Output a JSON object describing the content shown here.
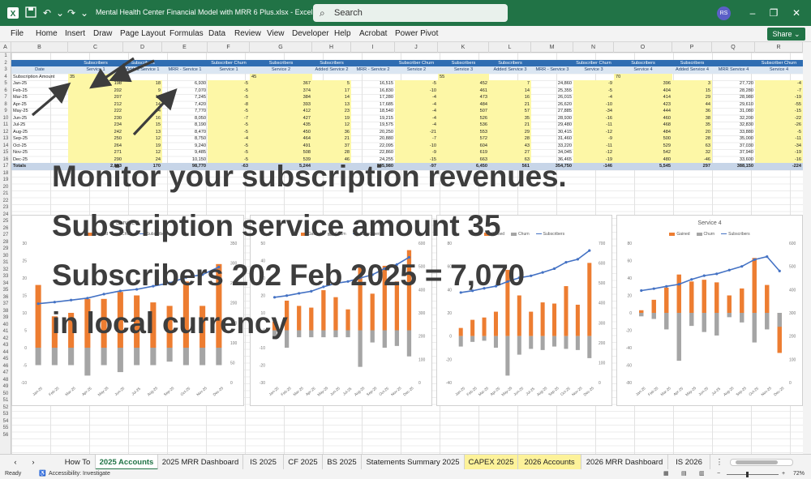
{
  "window": {
    "title": "Mental Health Center Financial Model with MRR 6 Plus.xlsx  -  Excel",
    "search_placeholder": "Search",
    "user_initials": "RS"
  },
  "ribbon": {
    "tabs": [
      "File",
      "Home",
      "Insert",
      "Draw",
      "Page Layout",
      "Formulas",
      "Data",
      "Review",
      "View",
      "Developer",
      "Help",
      "Acrobat",
      "Power Pivot"
    ],
    "share_label": "Share"
  },
  "columns": [
    "A",
    "B",
    "C",
    "D",
    "E",
    "F",
    "G",
    "H",
    "I",
    "J",
    "K",
    "L",
    "M",
    "N",
    "O",
    "P",
    "Q",
    "R"
  ],
  "rows": [
    "1",
    "2",
    "3",
    "4",
    "5",
    "6",
    "7",
    "8",
    "9",
    "10",
    "11",
    "12",
    "13",
    "14",
    "15",
    "16",
    "17",
    "18",
    "19",
    "20",
    "21",
    "22",
    "23",
    "24",
    "25",
    "26",
    "27",
    "28",
    "29",
    "30",
    "31",
    "32",
    "33",
    "34",
    "35",
    "36",
    "37",
    "38",
    "39",
    "40",
    "41",
    "42",
    "43",
    "44",
    "45",
    "46",
    "47",
    "48",
    "49",
    "50",
    "51",
    "52",
    "53",
    "54",
    "55",
    "56"
  ],
  "table": {
    "group_headers": [
      "Subscribers",
      "Subscribers",
      "",
      "Subscriber Churn",
      "Subscribers",
      "Subscribers",
      "",
      "Subscriber Churn",
      "Subscribers",
      "Subscribers",
      "",
      "Subscriber Churn",
      "Subscribers",
      "Subscribers",
      "",
      "Subscriber Churn"
    ],
    "col_headers": [
      "Date",
      "Service 1",
      "Added Service 1",
      "MRR - Service 1",
      "Service 1",
      "Service 2",
      "Added Service 2",
      "MRR - Service 2",
      "Service 2",
      "Service 3",
      "Added Service 3",
      "MRR - Service 3",
      "Service 3",
      "Service 4",
      "Added Service 4",
      "MRR Service 4",
      "Service 4"
    ],
    "amount_label": "Subscription Amount",
    "amounts": [
      "35",
      "45",
      "55",
      "70"
    ],
    "months": [
      "Jan-25",
      "Feb-25",
      "Mar-25",
      "Apr-25",
      "May-25",
      "Jun-25",
      "Jul-25",
      "Aug-25",
      "Sep-25",
      "Oct-25",
      "Nov-25",
      "Dec-25"
    ],
    "svc1": {
      "subs": [
        "198",
        "202",
        "207",
        "212",
        "222",
        "230",
        "234",
        "242",
        "250",
        "264",
        "271",
        "290"
      ],
      "added": [
        "18",
        "9",
        "10",
        "14",
        "14",
        "16",
        "15",
        "13",
        "12",
        "19",
        "12",
        "24"
      ],
      "mrr": [
        "6,930",
        "7,070",
        "7,245",
        "7,420",
        "7,770",
        "8,050",
        "8,190",
        "8,470",
        "8,750",
        "9,240",
        "9,485",
        "10,150"
      ],
      "churn": [
        "-5",
        "-5",
        "-5",
        "-8",
        "-5",
        "-7",
        "-5",
        "-5",
        "-4",
        "-5",
        "-5",
        "-5"
      ]
    },
    "svc2": {
      "subs": [
        "367",
        "374",
        "384",
        "393",
        "412",
        "427",
        "435",
        "450",
        "464",
        "491",
        "508",
        "539"
      ],
      "added": [
        "5",
        "17",
        "14",
        "13",
        "23",
        "19",
        "12",
        "36",
        "21",
        "37",
        "28",
        "46"
      ],
      "mrr": [
        "16,515",
        "16,830",
        "17,280",
        "17,685",
        "18,540",
        "19,215",
        "19,575",
        "20,250",
        "20,880",
        "22,095",
        "22,860",
        "24,255"
      ],
      "churn": [
        "-5",
        "-10",
        "-4",
        "-4",
        "-4",
        "-4",
        "-4",
        "-21",
        "-7",
        "-10",
        "-9",
        "-15"
      ]
    },
    "svc3": {
      "subs": [
        "452",
        "461",
        "473",
        "484",
        "507",
        "526",
        "536",
        "553",
        "572",
        "604",
        "619",
        "663"
      ],
      "added": [
        "7",
        "14",
        "16",
        "21",
        "57",
        "35",
        "21",
        "29",
        "28",
        "43",
        "27",
        "63"
      ],
      "mrr": [
        "24,860",
        "25,355",
        "26,015",
        "26,620",
        "27,885",
        "28,930",
        "29,480",
        "30,415",
        "31,460",
        "33,220",
        "34,045",
        "36,465"
      ],
      "churn": [
        "-9",
        "-5",
        "-4",
        "-10",
        "-34",
        "-16",
        "-11",
        "-12",
        "-9",
        "-11",
        "-12",
        "-19"
      ]
    },
    "svc4": {
      "subs": [
        "396",
        "404",
        "414",
        "423",
        "444",
        "460",
        "468",
        "484",
        "500",
        "529",
        "542",
        "480"
      ],
      "added": [
        "3",
        "15",
        "29",
        "44",
        "36",
        "38",
        "35",
        "20",
        "28",
        "63",
        "32",
        "-46"
      ],
      "mrr": [
        "27,720",
        "28,280",
        "28,980",
        "29,610",
        "31,080",
        "32,200",
        "32,830",
        "33,880",
        "35,000",
        "37,030",
        "37,940",
        "33,600"
      ],
      "churn": [
        "-4",
        "-7",
        "-19",
        "-55",
        "-15",
        "-22",
        "-26",
        "-5",
        "-11",
        "-34",
        "-19",
        "-16"
      ]
    },
    "totals_label": "Totals",
    "totals": [
      "2,823",
      "170",
      "98,770",
      "-63",
      "5,244",
      "",
      "235,980",
      "-97",
      "6,450",
      "561",
      "354,750",
      "-146",
      "5,545",
      "297",
      "388,150",
      "-224"
    ]
  },
  "chart_data": [
    {
      "type": "bar",
      "title": "Service 1",
      "legend": [
        "Gained",
        "Churn",
        "Subscribers"
      ],
      "categories": [
        "Jan-25",
        "Feb-25",
        "Mar-25",
        "Apr-25",
        "May-25",
        "Jun-25",
        "Jul-25",
        "Aug-25",
        "Sep-25",
        "Oct-25",
        "Nov-25",
        "Dec-25"
      ],
      "series": [
        {
          "name": "Gained",
          "values": [
            18,
            9,
            10,
            14,
            14,
            16,
            15,
            13,
            12,
            19,
            12,
            24
          ]
        },
        {
          "name": "Churn",
          "values": [
            -5,
            -5,
            -5,
            -8,
            -5,
            -7,
            -5,
            -5,
            -4,
            -5,
            -5,
            -5
          ]
        },
        {
          "name": "Subscribers",
          "values": [
            198,
            202,
            207,
            212,
            222,
            230,
            234,
            242,
            250,
            264,
            271,
            290
          ]
        }
      ],
      "ylim": [
        -10,
        30
      ],
      "y2lim": [
        0,
        350
      ],
      "yticks": [
        30,
        25,
        20,
        15,
        10,
        5,
        0,
        -5,
        -10
      ],
      "y2ticks": [
        350,
        300,
        250,
        200,
        150,
        100,
        50,
        0
      ]
    },
    {
      "type": "bar",
      "title": "",
      "legend": [
        "Gained",
        "Churn",
        "Subscribers"
      ],
      "categories": [
        "Jan-25",
        "Feb-25",
        "Mar-25",
        "Apr-25",
        "May-25",
        "Jun-25",
        "Jul-25",
        "Aug-25",
        "Sep-25",
        "Oct-25",
        "Nov-25",
        "Dec-25"
      ],
      "series": [
        {
          "name": "Gained",
          "values": [
            5,
            17,
            14,
            13,
            23,
            19,
            12,
            36,
            21,
            37,
            28,
            46
          ]
        },
        {
          "name": "Churn",
          "values": [
            -5,
            -10,
            -4,
            -4,
            -4,
            -4,
            -4,
            -21,
            -7,
            -10,
            -9,
            -15
          ]
        },
        {
          "name": "Subscribers",
          "values": [
            367,
            374,
            384,
            393,
            412,
            427,
            435,
            450,
            464,
            491,
            508,
            539
          ]
        }
      ],
      "ylim": [
        -30,
        50
      ],
      "y2lim": [
        0,
        600
      ],
      "yticks": [
        50,
        40,
        30,
        20,
        10,
        0,
        -10,
        -20,
        -30
      ],
      "y2ticks": [
        600,
        500,
        400,
        300,
        200,
        100,
        0
      ]
    },
    {
      "type": "bar",
      "title": "",
      "legend": [
        "Gained",
        "Churn",
        "Subscribers"
      ],
      "categories": [
        "Jan-25",
        "Feb-25",
        "Mar-25",
        "Apr-25",
        "May-25",
        "Jun-25",
        "Jul-25",
        "Aug-25",
        "Sep-25",
        "Oct-25",
        "Nov-25",
        "Dec-25"
      ],
      "series": [
        {
          "name": "Gained",
          "values": [
            7,
            14,
            16,
            21,
            57,
            35,
            21,
            29,
            28,
            43,
            27,
            63
          ]
        },
        {
          "name": "Churn",
          "values": [
            -9,
            -5,
            -4,
            -10,
            -34,
            -16,
            -11,
            -12,
            -9,
            -11,
            -12,
            -19
          ]
        },
        {
          "name": "Subscribers",
          "values": [
            452,
            461,
            473,
            484,
            507,
            526,
            536,
            553,
            572,
            604,
            619,
            663
          ]
        }
      ],
      "ylim": [
        -40,
        80
      ],
      "y2lim": [
        0,
        700
      ],
      "yticks": [
        80,
        60,
        40,
        20,
        0,
        -20,
        -40
      ],
      "y2ticks": [
        700,
        600,
        500,
        400,
        300,
        200,
        100,
        0
      ]
    },
    {
      "type": "bar",
      "title": "Service 4",
      "legend": [
        "Gained",
        "Churn",
        "Subscribers"
      ],
      "categories": [
        "Jan-25",
        "Feb-25",
        "Mar-25",
        "Apr-25",
        "May-25",
        "Jun-25",
        "Jul-25",
        "Aug-25",
        "Sep-25",
        "Oct-25",
        "Nov-25",
        "Dec-25"
      ],
      "series": [
        {
          "name": "Gained",
          "values": [
            3,
            15,
            29,
            44,
            36,
            38,
            35,
            20,
            28,
            63,
            32,
            -46
          ]
        },
        {
          "name": "Churn",
          "values": [
            -4,
            -7,
            -19,
            -55,
            -15,
            -22,
            -26,
            -5,
            -11,
            -34,
            -19,
            -16
          ]
        },
        {
          "name": "Subscribers",
          "values": [
            396,
            404,
            414,
            423,
            444,
            460,
            468,
            484,
            500,
            529,
            542,
            480
          ]
        }
      ],
      "ylim": [
        -80,
        80
      ],
      "y2lim": [
        0,
        600
      ],
      "yticks": [
        80,
        60,
        40,
        20,
        0,
        -20,
        -40,
        -60,
        -80
      ],
      "y2ticks": [
        600,
        500,
        400,
        300,
        200,
        100,
        0
      ]
    }
  ],
  "overlay": {
    "line1": "Monitor your subscription revenues.",
    "line2": "Subscription service amount 35",
    "line3": "Subscribers 202 Feb 2025 = 7,070",
    "line4": "in local currency"
  },
  "sheet_tabs": [
    "How To",
    "2025 Accounts",
    "2025 MRR Dashboard",
    "IS 2025",
    "CF 2025",
    "BS 2025",
    "Statements Summary 2025",
    "CAPEX 2025",
    "2026 Accounts",
    "2026 MRR Dashboard",
    "IS 2026"
  ],
  "active_tab": "2025 Accounts",
  "status": {
    "ready": "Ready",
    "accessibility": "Accessibility: Investigate",
    "zoom": "72%"
  },
  "colors": {
    "excel_green": "#217346",
    "header_blue": "#2f6db2",
    "yellow": "#fdf7a6",
    "gained": "#ed7d31",
    "churn": "#a5a5a5",
    "subscribers": "#4472c4"
  }
}
